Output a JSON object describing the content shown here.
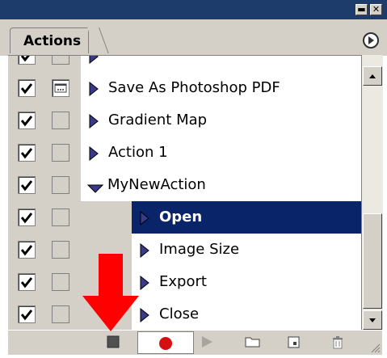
{
  "window": {
    "minimize_glyph": "▬",
    "close_glyph": "✕"
  },
  "panel": {
    "tab_label": "Actions",
    "menu_icon": "circle-triangle-right-icon"
  },
  "actions": [
    {
      "label": "",
      "checked": true,
      "dialog": false,
      "indent": 0,
      "expanded": false,
      "selected": false,
      "partial": true
    },
    {
      "label": "Save As Photoshop PDF",
      "checked": true,
      "dialog": true,
      "indent": 0,
      "expanded": false,
      "selected": false
    },
    {
      "label": "Gradient Map",
      "checked": true,
      "dialog": false,
      "indent": 0,
      "expanded": false,
      "selected": false
    },
    {
      "label": "Action 1",
      "checked": true,
      "dialog": false,
      "indent": 0,
      "expanded": false,
      "selected": false
    },
    {
      "label": "MyNewAction",
      "checked": true,
      "dialog": false,
      "indent": 0,
      "expanded": true,
      "selected": false
    },
    {
      "label": "Open",
      "checked": true,
      "dialog": false,
      "indent": 1,
      "expanded": false,
      "selected": true
    },
    {
      "label": "Image Size",
      "checked": true,
      "dialog": false,
      "indent": 1,
      "expanded": false,
      "selected": false
    },
    {
      "label": "Export",
      "checked": true,
      "dialog": false,
      "indent": 1,
      "expanded": false,
      "selected": false
    },
    {
      "label": "Close",
      "checked": true,
      "dialog": false,
      "indent": 1,
      "expanded": false,
      "selected": false
    }
  ],
  "toolbar": {
    "buttons": [
      {
        "name": "stop-icon",
        "active": false
      },
      {
        "name": "record-icon",
        "active": true
      },
      {
        "name": "play-icon",
        "active": false
      },
      {
        "name": "folder-icon",
        "active": false
      },
      {
        "name": "new-action-icon",
        "active": false
      },
      {
        "name": "trash-icon",
        "active": false
      }
    ]
  },
  "colors": {
    "title_bar": "#1d3c6c",
    "selection": "#0a246a",
    "expand_triangle": "#3a3a8c",
    "annotation_arrow": "#ff0000",
    "record": "#d41010"
  }
}
